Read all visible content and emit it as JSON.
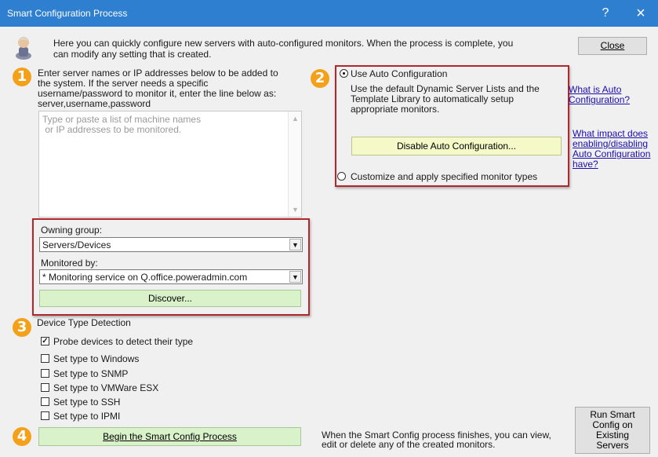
{
  "window": {
    "title": "Smart Configuration Process",
    "help_glyph": "?",
    "close_glyph": "×"
  },
  "intro": {
    "line1": "Here you can quickly configure new servers with auto-configured monitors. When the process is complete, you",
    "line2": "can modify any setting that is created."
  },
  "close_button": "Close",
  "step_numbers": [
    "1",
    "2",
    "3",
    "4"
  ],
  "step1": {
    "line1": "Enter server names or IP addresses below to be added to",
    "line2": "the system.  If the server needs a specific",
    "line3": "username/password to monitor it, enter the line below as:",
    "line4": "server,username,password",
    "placeholder_line1": "Type or paste a list of machine names",
    "placeholder_line2": " or IP addresses to be monitored."
  },
  "grouping": {
    "owning_group_label": "Owning group:",
    "owning_group_value": "Servers/Devices",
    "monitored_by_label": "Monitored by:",
    "monitored_by_value": "* Monitoring service on Q.office.poweradmin.com",
    "discover_button": "Discover..."
  },
  "step2": {
    "use_auto_label": "Use Auto Configuration",
    "desc_line1": "Use the default Dynamic Server Lists and the",
    "desc_line2": "Template Library to automatically setup",
    "desc_line3": "appropriate monitors.",
    "disable_button": "Disable Auto Configuration...",
    "customize_label": "Customize and apply specified monitor types",
    "use_auto_selected": true
  },
  "links": {
    "what_is_line1": "What is Auto",
    "what_is_line2": "Configuration?",
    "impact_line1": "What impact does",
    "impact_line2": "enabling/disabling",
    "impact_line3": "Auto Configuration",
    "impact_line4": "have?"
  },
  "step3": {
    "heading": "Device Type Detection",
    "probe_label": "Probe devices to detect their type",
    "probe_checked": true,
    "types": [
      {
        "label": "Set type to Windows",
        "checked": false
      },
      {
        "label": "Set type to SNMP",
        "checked": false
      },
      {
        "label": "Set type to VMWare ESX",
        "checked": false
      },
      {
        "label": "Set type to SSH",
        "checked": false
      },
      {
        "label": "Set type to IPMI",
        "checked": false
      }
    ]
  },
  "step4": {
    "begin_button": "Begin the Smart Config Process",
    "note_line1": "When the Smart Config process finishes, you can view,",
    "note_line2": "edit or delete any of the created monitors."
  },
  "run_existing_button": {
    "line1": "Run Smart",
    "line2": "Config on",
    "line3": "Existing",
    "line4": "Servers"
  },
  "check_glyph": "✓",
  "colors": {
    "title_bar": "#2f7fd0",
    "step_badge": "#f3a11a",
    "highlight_border": "#b0272c",
    "link": "#1a0dab"
  }
}
